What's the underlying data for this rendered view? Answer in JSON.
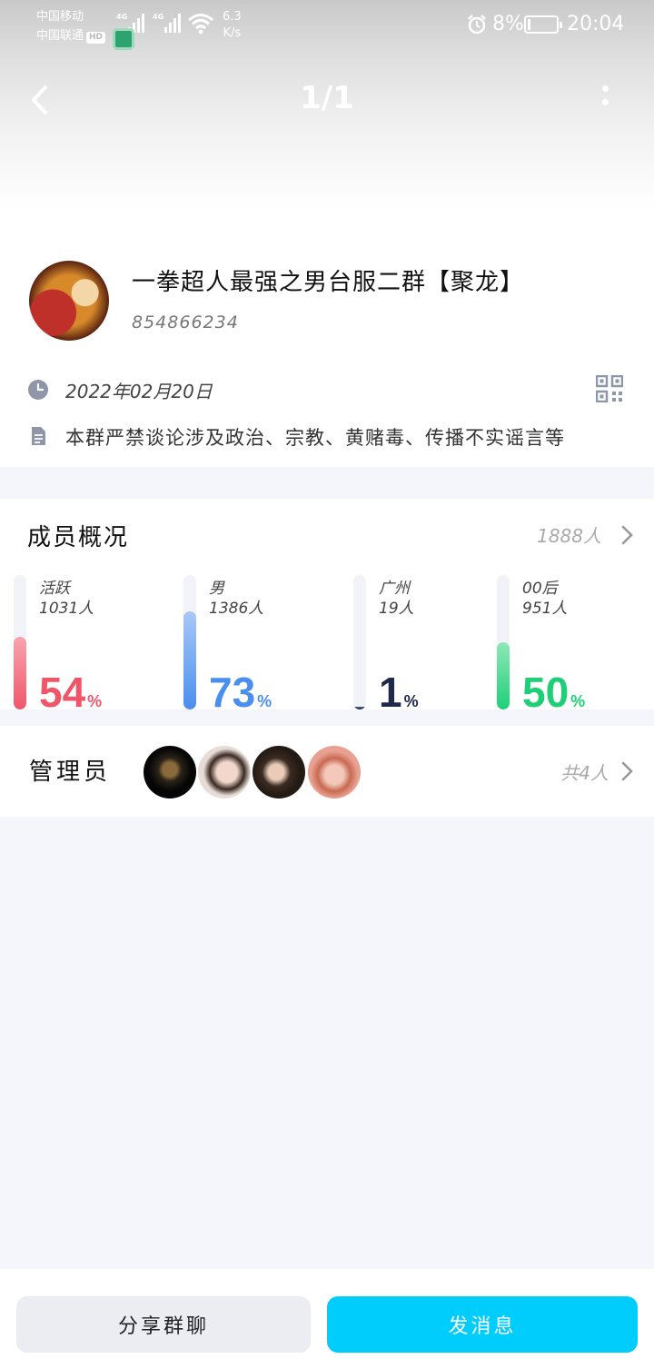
{
  "status_bar": {
    "carrier_1": "中国移动",
    "carrier_2": "中国联通",
    "hd_badge": "HD",
    "network_1": "4G",
    "network_2": "4G",
    "speed_value": "6.3",
    "speed_unit": "K/s",
    "battery_percent": "8%",
    "battery_level": 0.08,
    "time": "20:04"
  },
  "navbar": {
    "page_indicator": "1/1"
  },
  "group": {
    "name": "一拳超人最强之男台服二群【聚龙】",
    "id": "854866234",
    "created_date": "2022年02月20日",
    "notice": "本群严禁谈论涉及政治、宗教、黄赌毒、传播不实谣言等"
  },
  "members": {
    "title": "成员概况",
    "total": "1888人",
    "stats": [
      {
        "label": "活跃",
        "count": "1031人",
        "percent": 54,
        "unit": "%",
        "color": "#f0566a",
        "color_light": "#f8a4ae"
      },
      {
        "label": "男",
        "count": "1386人",
        "percent": 73,
        "unit": "%",
        "color": "#4a8ef0",
        "color_light": "#a8c8f8"
      },
      {
        "label": "广州",
        "count": "19人",
        "percent": 1,
        "unit": "%",
        "color": "#1f2a4a",
        "color_light": "#55607e"
      },
      {
        "label": "00后",
        "count": "951人",
        "percent": 50,
        "unit": "%",
        "color": "#1fcf78",
        "color_light": "#8ee8b8"
      }
    ]
  },
  "admins": {
    "title": "管理员",
    "count_text": "共4人"
  },
  "actions": {
    "share_label": "分享群聊",
    "send_label": "发消息"
  },
  "colors": {
    "accent": "#00cdfb",
    "page_bg": "#f5f6fb"
  }
}
